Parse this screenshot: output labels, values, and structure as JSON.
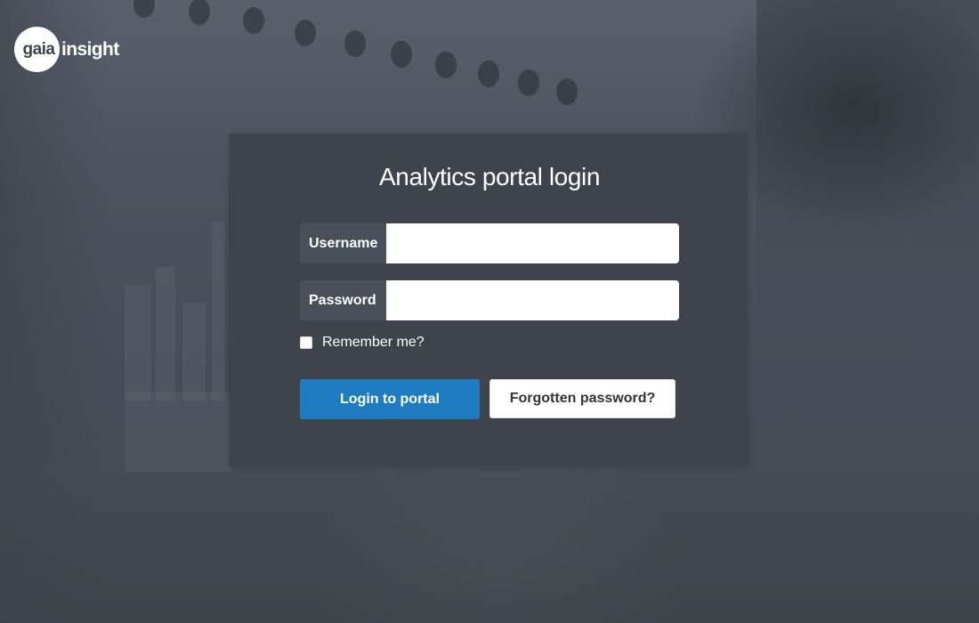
{
  "brand": {
    "logo_mark": "gaia",
    "logo_text": "insight"
  },
  "login": {
    "title": "Analytics portal login",
    "username_label": "Username",
    "username_value": "",
    "password_label": "Password",
    "password_value": "",
    "remember_label": "Remember me?",
    "remember_checked": false,
    "login_button": "Login to portal",
    "forgot_button": "Forgotten password?"
  },
  "colors": {
    "card_bg": "#3f444c",
    "primary_button": "#1f7cc1",
    "page_bg": "#4a5059"
  }
}
